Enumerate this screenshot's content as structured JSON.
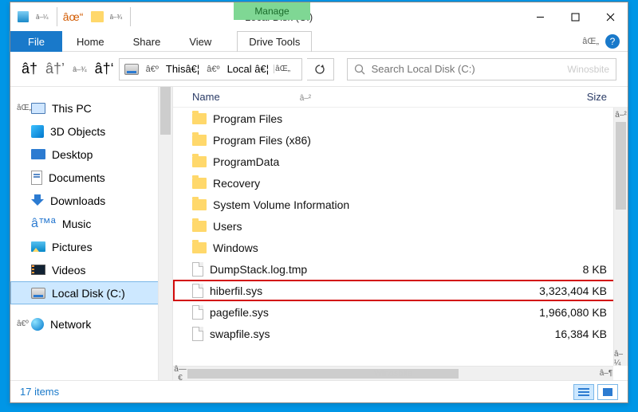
{
  "qat": {
    "label1": "",
    "label2": ""
  },
  "title": "Local Disk (C:)",
  "contextual_tab": "Manage",
  "tabs": {
    "file": "File",
    "home": "Home",
    "share": "Share",
    "view": "View",
    "drive_tools": "Drive Tools"
  },
  "nav": {
    "seg1": "Thisâ€¦",
    "seg2": "Local â€¦"
  },
  "search": {
    "placeholder": "Search Local Disk (C:)",
    "watermark": "Winosbite"
  },
  "sidebar": [
    {
      "label": "This PC",
      "icon": "pc",
      "caret": true
    },
    {
      "label": "3D Objects",
      "icon": "3d"
    },
    {
      "label": "Desktop",
      "icon": "desktop"
    },
    {
      "label": "Documents",
      "icon": "doc"
    },
    {
      "label": "Downloads",
      "icon": "download"
    },
    {
      "label": "Music",
      "icon": "music"
    },
    {
      "label": "Pictures",
      "icon": "pic"
    },
    {
      "label": "Videos",
      "icon": "vid"
    },
    {
      "label": "Local Disk (C:)",
      "icon": "disk",
      "selected": true
    },
    {
      "spacer": true
    },
    {
      "label": "Network",
      "icon": "net",
      "caret": true
    }
  ],
  "columns": {
    "name": "Name",
    "size": "Size"
  },
  "files": [
    {
      "name": "Program Files",
      "type": "folder",
      "size": ""
    },
    {
      "name": "Program Files (x86)",
      "type": "folder",
      "size": ""
    },
    {
      "name": "ProgramData",
      "type": "folder",
      "size": ""
    },
    {
      "name": "Recovery",
      "type": "folder",
      "size": ""
    },
    {
      "name": "System Volume Information",
      "type": "folder",
      "size": ""
    },
    {
      "name": "Users",
      "type": "folder",
      "size": ""
    },
    {
      "name": "Windows",
      "type": "folder",
      "size": ""
    },
    {
      "name": "DumpStack.log.tmp",
      "type": "file",
      "size": "8 KB"
    },
    {
      "name": "hiberfil.sys",
      "type": "file",
      "size": "3,323,404 KB",
      "highlight": true
    },
    {
      "name": "pagefile.sys",
      "type": "file",
      "size": "1,966,080 KB"
    },
    {
      "name": "swapfile.sys",
      "type": "file",
      "size": "16,384 KB"
    }
  ],
  "hscroll_watermark": "Winosbite",
  "status": {
    "items": "17 items"
  }
}
